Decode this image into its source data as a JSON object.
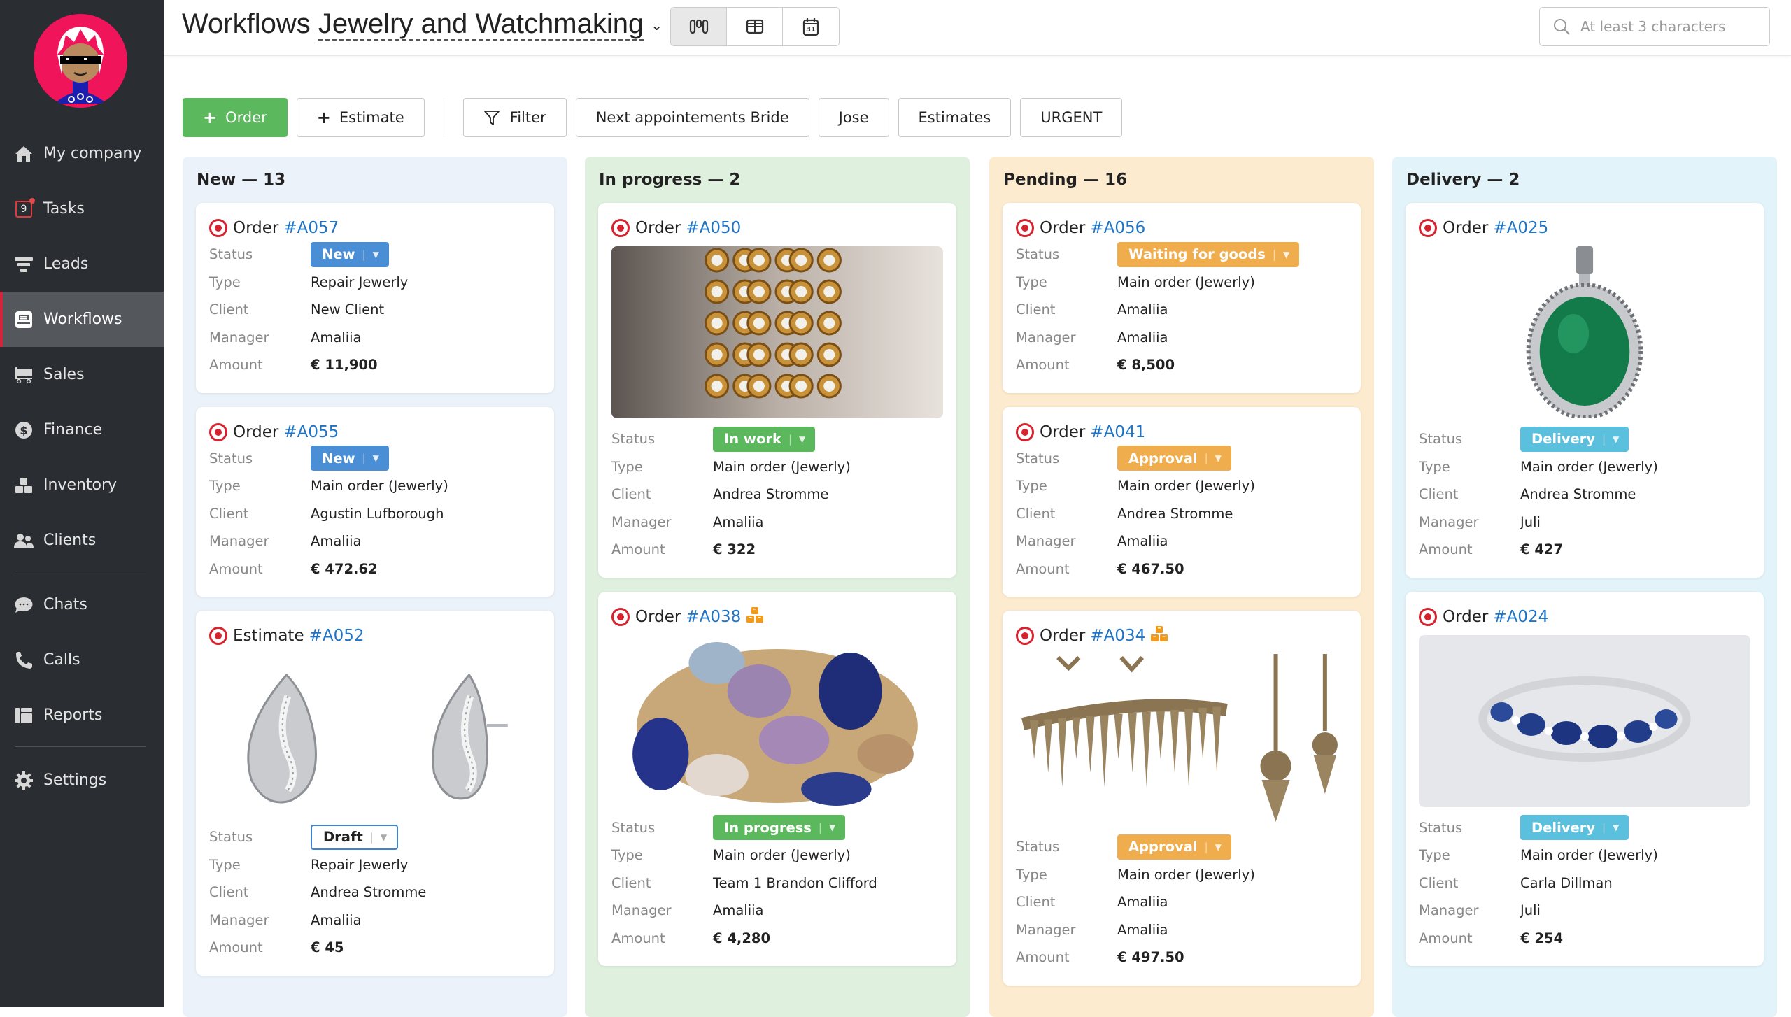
{
  "sidebar": {
    "items": [
      {
        "label": "My company",
        "icon": "home-icon"
      },
      {
        "label": "Tasks",
        "icon": "tasks-icon",
        "badge": "9"
      },
      {
        "label": "Leads",
        "icon": "funnel-icon"
      },
      {
        "label": "Workflows",
        "icon": "workflows-icon",
        "active": true
      },
      {
        "label": "Sales",
        "icon": "cart-icon"
      },
      {
        "label": "Finance",
        "icon": "dollar-icon"
      },
      {
        "label": "Inventory",
        "icon": "boxes-icon"
      },
      {
        "label": "Clients",
        "icon": "users-icon"
      },
      {
        "label": "Chats",
        "icon": "chat-icon"
      },
      {
        "label": "Calls",
        "icon": "phone-icon"
      },
      {
        "label": "Reports",
        "icon": "reports-icon"
      },
      {
        "label": "Settings",
        "icon": "gear-icon"
      }
    ]
  },
  "header": {
    "title_prefix": "Workflows",
    "pipeline": "Jewelry and Watchmaking",
    "views": [
      "kanban-view",
      "table-view",
      "calendar-view"
    ],
    "active_view": "kanban-view",
    "calendar_day": "31",
    "search_placeholder": "At least 3 characters"
  },
  "toolbar": {
    "order_label": "Order",
    "estimate_label": "Estimate",
    "filter_label": "Filter",
    "saved_filters": [
      "Next appointements Bride",
      "Jose",
      "Estimates",
      "URGENT"
    ]
  },
  "labels": {
    "status": "Status",
    "type": "Type",
    "client": "Client",
    "manager": "Manager",
    "amount": "Amount"
  },
  "columns": [
    {
      "title": "New — 13",
      "bg": "#ebf2fa",
      "cards": [
        {
          "kind": "Order",
          "number": "#A057",
          "status": "New",
          "status_color": "#4a8fd6",
          "type": "Repair Jewerly",
          "client": "New Client",
          "manager": "Amaliia",
          "amount": "€ 11,900"
        },
        {
          "kind": "Order",
          "number": "#A055",
          "status": "New",
          "status_color": "#4a8fd6",
          "type": "Main order (Jewerly)",
          "client": "Agustin Lufborough",
          "manager": "Amaliia",
          "amount": "€ 472.62"
        },
        {
          "kind": "Estimate",
          "number": "#A052",
          "status": "Draft",
          "status_style": "draft",
          "image": "earrings",
          "type": "Repair Jewerly",
          "client": "Andrea Stromme",
          "manager": "Amaliia",
          "amount": "€ 45"
        }
      ]
    },
    {
      "title": "In progress — 2",
      "bg": "#dff0de",
      "cards": [
        {
          "kind": "Order",
          "number": "#A050",
          "status": "In work",
          "status_color": "#5cb85c",
          "image": "gold-rings",
          "type": "Main order (Jewerly)",
          "client": "Andrea Stromme",
          "manager": "Amaliia",
          "amount": "€ 322"
        },
        {
          "kind": "Order",
          "number": "#A038",
          "status": "In progress",
          "status_color": "#5cb85c",
          "image": "gem-rings",
          "inventory_flag": true,
          "type": "Main order (Jewerly)",
          "client": "Team 1 Brandon Clifford",
          "manager": "Amaliia",
          "amount": "€ 4,280"
        }
      ]
    },
    {
      "title": "Pending — 16",
      "bg": "#fdebcf",
      "cards": [
        {
          "kind": "Order",
          "number": "#A056",
          "status": "Waiting for goods",
          "status_color": "#f0ad4e",
          "type": "Main order (Jewerly)",
          "client": "Amaliia",
          "manager": "Amaliia",
          "amount": "€ 8,500"
        },
        {
          "kind": "Order",
          "number": "#A041",
          "status": "Approval",
          "status_color": "#f0ad4e",
          "type": "Main order (Jewerly)",
          "client": "Andrea Stromme",
          "manager": "Amaliia",
          "amount": "€ 467.50"
        },
        {
          "kind": "Order",
          "number": "#A034",
          "status": "Approval",
          "status_color": "#f0ad4e",
          "image": "necklace",
          "inventory_flag": true,
          "type": "Main order (Jewerly)",
          "client": "Amaliia",
          "manager": "Amaliia",
          "amount": "€ 497.50"
        }
      ]
    },
    {
      "title": "Delivery — 2",
      "bg": "#e2f3f9",
      "cards": [
        {
          "kind": "Order",
          "number": "#A025",
          "status": "Delivery",
          "status_color": "#5bc0de",
          "image": "pendant",
          "type": "Main order (Jewerly)",
          "client": "Andrea Stromme",
          "manager": "Juli",
          "amount": "€ 427"
        },
        {
          "kind": "Order",
          "number": "#A024",
          "status": "Delivery",
          "status_color": "#5bc0de",
          "image": "sapphire-ring",
          "type": "Main order (Jewerly)",
          "client": "Carla Dillman",
          "manager": "Juli",
          "amount": "€ 254"
        }
      ]
    }
  ],
  "colors": {
    "accent_red": "#d8222e",
    "link_blue": "#1f74c6",
    "sidebar_bg": "#2a2e33",
    "primary_green": "#5cb85c"
  }
}
